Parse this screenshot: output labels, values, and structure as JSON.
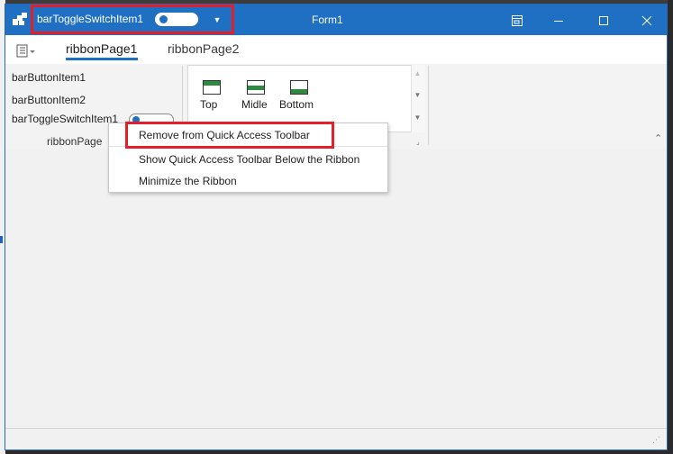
{
  "window": {
    "title": "Form1"
  },
  "quick_access_toolbar": {
    "toggle_label": "barToggleSwitchItem1",
    "toggle_state": "off",
    "customize_icon": "chevron-down-icon"
  },
  "ribbon": {
    "tabs": [
      {
        "label": "ribbonPage1",
        "selected": true
      },
      {
        "label": "ribbonPage2",
        "selected": false
      }
    ],
    "group1": {
      "items": [
        {
          "label": "barButtonItem1"
        },
        {
          "label": "barButtonItem2"
        },
        {
          "label": "barToggleSwitchItem1"
        }
      ],
      "caption": "ribbonPage"
    },
    "gallery": {
      "items": [
        {
          "label": "Top"
        },
        {
          "label": "Midle"
        },
        {
          "label": "Bottom"
        }
      ]
    }
  },
  "context_menu": {
    "items": [
      {
        "label": "Remove from Quick Access Toolbar",
        "highlighted": true
      },
      {
        "label": "Show Quick Access Toolbar Below the Ribbon"
      },
      {
        "label": "Minimize the Ribbon"
      }
    ]
  },
  "colors": {
    "titlebar": "#1f6fc3",
    "highlight": "#e3202a",
    "gallery_bar": "#2d8a3f"
  }
}
